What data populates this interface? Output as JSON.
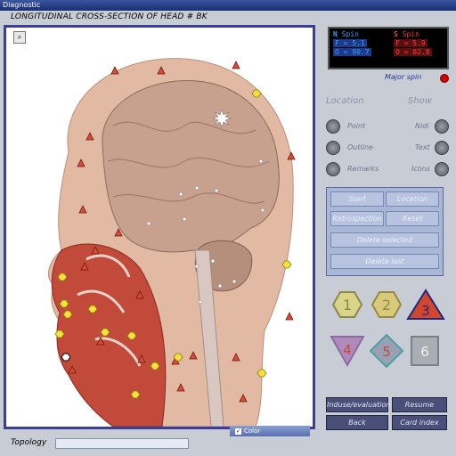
{
  "window": {
    "title": "Diagnostic"
  },
  "header": {
    "title": "LONGITUDINAL CROSS-SECTION OF HEAD # BK"
  },
  "viewer": {
    "color_label": "Color",
    "topology_label": "Topology"
  },
  "readout": {
    "north_label": "N",
    "north_spin": "Spin",
    "north_f": "F = 5.1",
    "north_o": "O = 90.7",
    "south_label": "S",
    "south_spin": "Spin",
    "south_f": "F = 5.9",
    "south_o": "O = 82.8"
  },
  "major_spin": {
    "label": "Major spin",
    "color": "#d10000"
  },
  "location": {
    "heading": "Location",
    "items": [
      "Point",
      "Outline",
      "Remarks"
    ]
  },
  "show": {
    "heading": "Show",
    "items": [
      "Nidi",
      "Text",
      "Icons"
    ]
  },
  "controls": {
    "start": "Start",
    "location": "Location",
    "retrospection": "Retrospection",
    "reset": "Reset",
    "delete_selected": "Delete selected",
    "delete_last": "Delete last"
  },
  "shapes": [
    "1",
    "2",
    "3",
    "4",
    "5",
    "6"
  ],
  "bottom": {
    "induse": "Induse/evaluation",
    "resume": "Resume",
    "back": "Back",
    "card_index": "Card index"
  },
  "colors": {
    "frame": "#3a3e9a",
    "accent_red": "#d10000",
    "panel": "#a9b6d4"
  }
}
